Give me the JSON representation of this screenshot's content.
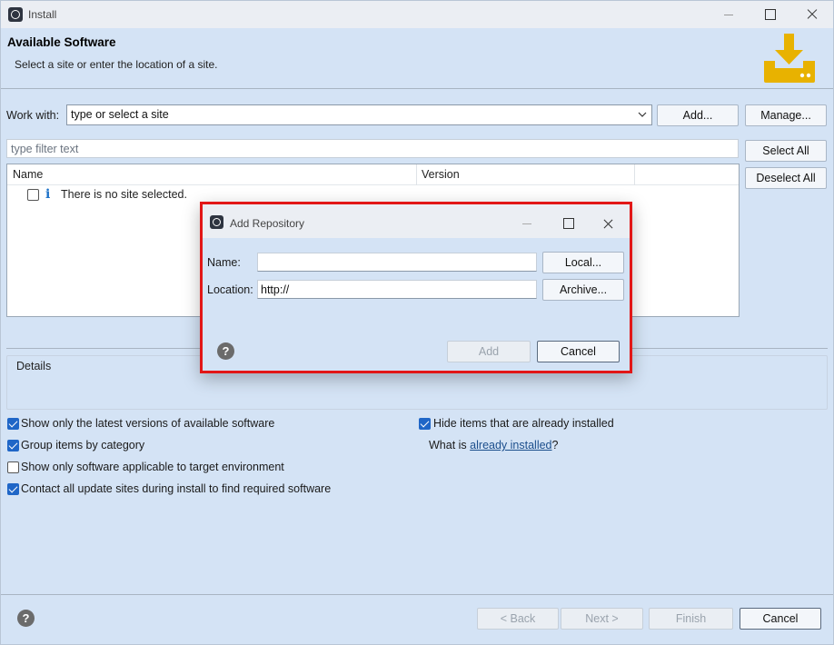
{
  "window": {
    "title": "Install",
    "icon": "eclipse-icon"
  },
  "header": {
    "title": "Available Software",
    "subtitle": "Select a site or enter the location of a site.",
    "icon": "download-icon",
    "icon_color": "#e8b200"
  },
  "work_with": {
    "label": "Work with:",
    "value": "type or select a site",
    "add_label": "Add...",
    "manage_label": "Manage..."
  },
  "filter": {
    "placeholder": "type filter text"
  },
  "buttons": {
    "select_all": "Select All",
    "deselect_all": "Deselect All"
  },
  "table": {
    "columns": [
      "Name",
      "Version"
    ],
    "rows": [
      {
        "text": "There is no site selected.",
        "checked": false,
        "icon": "info-icon"
      }
    ]
  },
  "details": {
    "label": "Details"
  },
  "options": {
    "show_latest": {
      "label": "Show only the latest versions of available software",
      "checked": true
    },
    "group_by_category": {
      "label": "Group items by category",
      "checked": true
    },
    "show_applicable": {
      "label": "Show only software applicable to target environment",
      "checked": false
    },
    "contact_all_sites": {
      "label": "Contact all update sites during install to find required software",
      "checked": true
    },
    "hide_installed": {
      "label": "Hide items that are already installed",
      "checked": true
    },
    "what_is_prefix": "What is",
    "already_installed_link": "already installed",
    "what_is_suffix": "?"
  },
  "footer": {
    "back": "< Back",
    "next": "Next >",
    "finish": "Finish",
    "cancel": "Cancel",
    "help": "?"
  },
  "dialog": {
    "title": "Add Repository",
    "name_label": "Name:",
    "name_value": "",
    "location_label": "Location:",
    "location_value": "http://",
    "local_label": "Local...",
    "archive_label": "Archive...",
    "add_label": "Add",
    "cancel_label": "Cancel",
    "help": "?",
    "highlight_color": "#e21717"
  }
}
